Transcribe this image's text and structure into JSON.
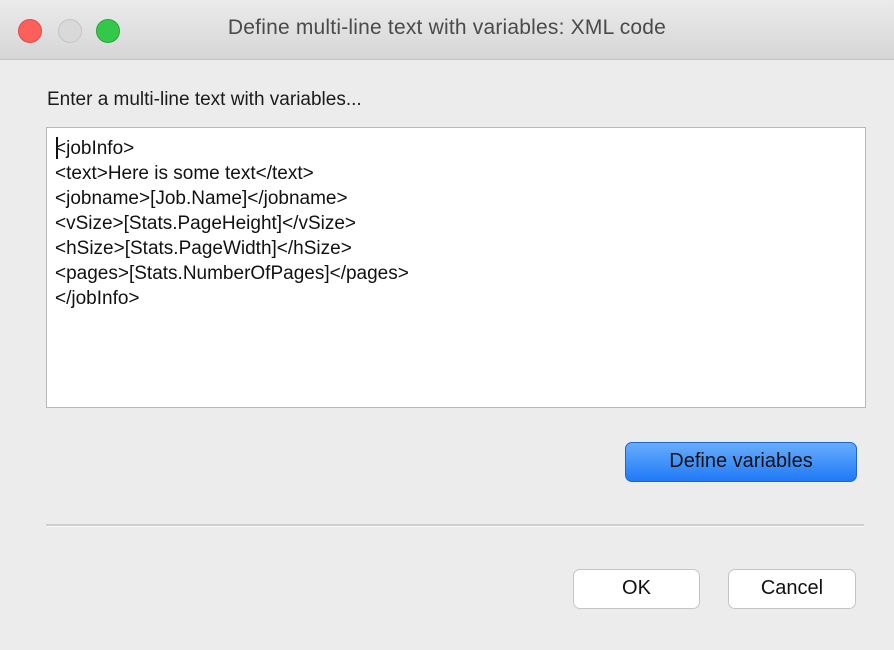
{
  "window": {
    "title": "Define multi-line text with variables: XML code"
  },
  "dialog": {
    "prompt": "Enter a multi-line text with variables...",
    "code_lines": [
      "<jobInfo>",
      "<text>Here is some text</text>",
      "<jobname>[Job.Name]</jobname>",
      "<vSize>[Stats.PageHeight]</vSize>",
      "<hSize>[Stats.PageWidth]</hSize>",
      "<pages>[Stats.NumberOfPages]</pages>",
      "</jobInfo>"
    ],
    "define_variables_label": "Define variables",
    "ok_label": "OK",
    "cancel_label": "Cancel"
  },
  "colors": {
    "close": "#fc605c",
    "minimize": "#d9d9d9",
    "zoom": "#34c84a",
    "primary_button": "#1f79f6"
  }
}
